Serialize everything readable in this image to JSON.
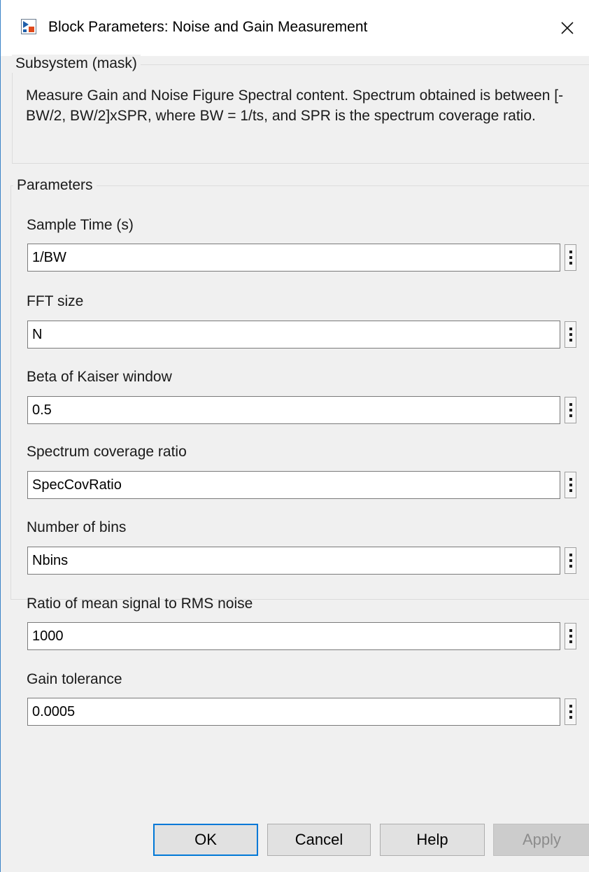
{
  "window": {
    "title": "Block Parameters: Noise and Gain Measurement",
    "close_icon": "close-x",
    "app_icon": "simulink-block-icon"
  },
  "mask": {
    "legend": "Subsystem (mask)",
    "description": "Measure Gain and Noise Figure Spectral content. Spectrum obtained is between [-BW/2, BW/2]xSPR, where BW = 1/ts, and SPR is the spectrum coverage ratio."
  },
  "parameters": {
    "legend": "Parameters",
    "fields": [
      {
        "label": "Sample Time (s)",
        "value": "1/BW"
      },
      {
        "label": "FFT size",
        "value": "N"
      },
      {
        "label": "Beta of Kaiser window",
        "value": "0.5"
      },
      {
        "label": "Spectrum coverage ratio",
        "value": "SpecCovRatio"
      },
      {
        "label": "Number of bins",
        "value": "Nbins"
      },
      {
        "label": "Ratio of mean signal to RMS noise",
        "value": "1000"
      },
      {
        "label": "Gain tolerance",
        "value": "0.0005"
      }
    ]
  },
  "buttons": {
    "ok": "OK",
    "cancel": "Cancel",
    "help": "Help",
    "apply": "Apply",
    "apply_enabled": false
  },
  "colors": {
    "window_bg": "#f0f0f0",
    "ok_focus_border": "#0078d7",
    "icon_blue": "#1f5ea8",
    "icon_orange": "#e0491b"
  }
}
